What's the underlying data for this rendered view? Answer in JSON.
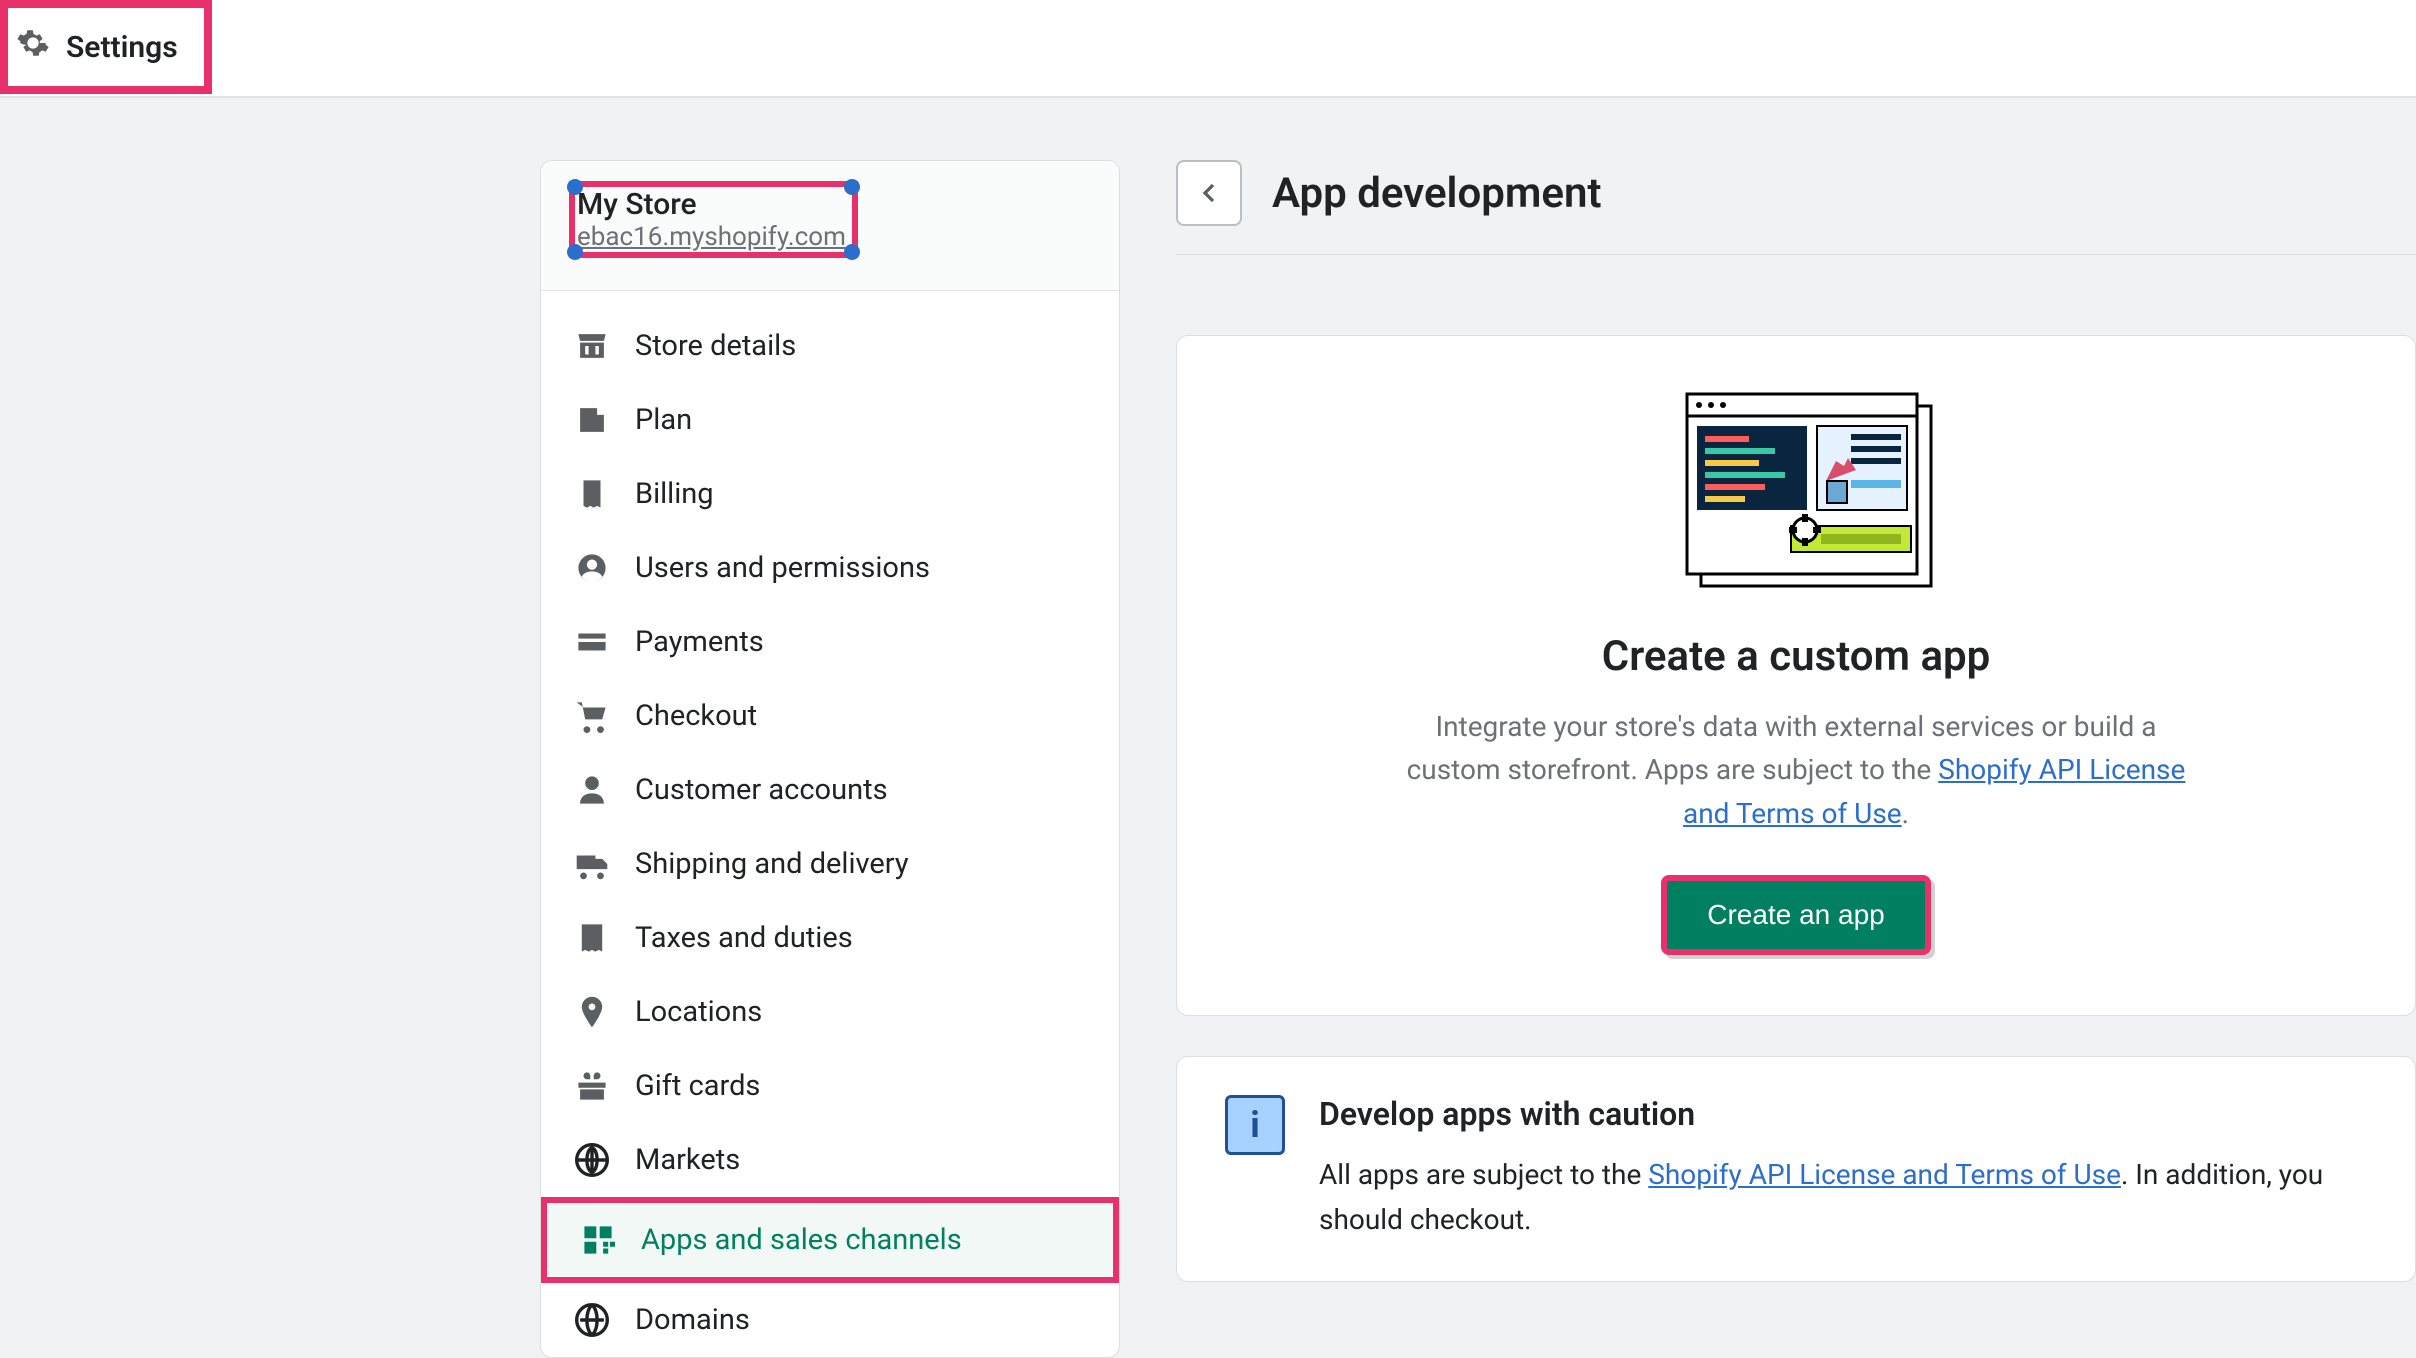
{
  "topbar": {
    "settings_label": "Settings"
  },
  "store": {
    "name": "My Store",
    "url": "ebac16.myshopify.com"
  },
  "nav": [
    {
      "key": "store-details",
      "label": "Store details",
      "icon": "storefront",
      "active": false
    },
    {
      "key": "plan",
      "label": "Plan",
      "icon": "plan",
      "active": false
    },
    {
      "key": "billing",
      "label": "Billing",
      "icon": "billing",
      "active": false
    },
    {
      "key": "users",
      "label": "Users and permissions",
      "icon": "person-circle",
      "active": false
    },
    {
      "key": "payments",
      "label": "Payments",
      "icon": "card",
      "active": false
    },
    {
      "key": "checkout",
      "label": "Checkout",
      "icon": "cart",
      "active": false
    },
    {
      "key": "customer-accounts",
      "label": "Customer accounts",
      "icon": "person",
      "active": false
    },
    {
      "key": "shipping",
      "label": "Shipping and delivery",
      "icon": "truck",
      "active": false
    },
    {
      "key": "taxes",
      "label": "Taxes and duties",
      "icon": "receipt",
      "active": false
    },
    {
      "key": "locations",
      "label": "Locations",
      "icon": "pin",
      "active": false
    },
    {
      "key": "gift-cards",
      "label": "Gift cards",
      "icon": "gift",
      "active": false
    },
    {
      "key": "markets",
      "label": "Markets",
      "icon": "globe-grid",
      "active": false
    },
    {
      "key": "apps",
      "label": "Apps and sales channels",
      "icon": "apps",
      "active": true
    },
    {
      "key": "domains",
      "label": "Domains",
      "icon": "globe",
      "active": false
    }
  ],
  "header": {
    "title": "App development"
  },
  "empty_state": {
    "title": "Create a custom app",
    "desc_pre": "Integrate your store's data with external services or build a custom storefront. Apps are subject to the ",
    "link_text": "Shopify API License and Terms of Use",
    "desc_post": ".",
    "button_label": "Create an app"
  },
  "caution": {
    "title": "Develop apps with caution",
    "text_pre": "All apps are subject to the ",
    "link_text": "Shopify API License and Terms of Use",
    "text_post": ". In addition, you should checkout."
  }
}
